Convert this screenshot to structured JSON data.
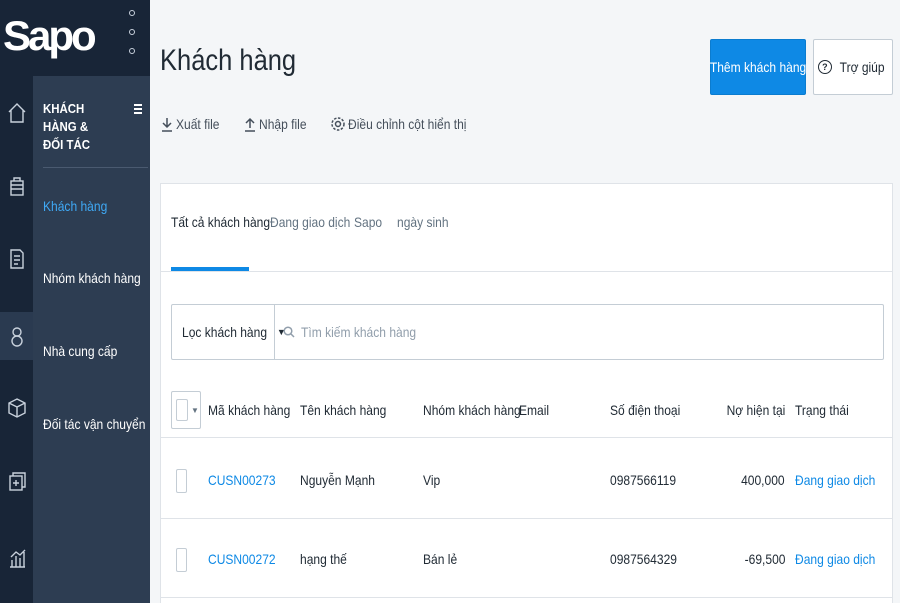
{
  "app": {
    "logo_text": "Sapo"
  },
  "rail": {
    "icons": [
      "home-icon",
      "products-icon",
      "orders-icon",
      "customers-icon",
      "box-icon",
      "inventory-icon",
      "reports-icon"
    ]
  },
  "submenu": {
    "heading": "KHÁCH HÀNG & ĐỐI TÁC",
    "items": [
      {
        "label": "Khách hàng",
        "active": true
      },
      {
        "label": "Nhóm khách hàng"
      },
      {
        "label": "Nhà cung cấp"
      },
      {
        "label": "Đối tác vận chuyển"
      }
    ]
  },
  "header": {
    "title": "Khách hàng",
    "add_button": "Thêm khách hàng",
    "help_button": "Trợ giúp"
  },
  "actions": {
    "export": "Xuất file",
    "import": "Nhập file",
    "columns": "Điều chỉnh cột hiển thị"
  },
  "tabs": [
    {
      "label": "Tất cả khách hàng",
      "active": true
    },
    {
      "label": "Đang giao dịch"
    },
    {
      "label": "Sapo"
    },
    {
      "label": "ngày sinh"
    }
  ],
  "filter": {
    "button": "Lọc khách hàng",
    "search_placeholder": "Tìm kiếm khách hàng"
  },
  "table": {
    "columns": [
      "Mã khách hàng",
      "Tên khách hàng",
      "Nhóm khách hàng",
      "Email",
      "Số điện thoại",
      "Nợ hiện tại",
      "Trạng thái"
    ],
    "rows": [
      {
        "code": "CUSN00273",
        "name": "Nguyễn Mạnh",
        "group": "Vip",
        "email": "",
        "phone": "0987566119",
        "debt": "400,000",
        "status": "Đang giao dịch"
      },
      {
        "code": "CUSN00272",
        "name": "hạng thế",
        "group": "Bán lẻ",
        "email": "",
        "phone": "0987564329",
        "debt": "-69,500",
        "status": "Đang giao dịch"
      }
    ]
  },
  "colors": {
    "accent": "#0e89e5",
    "sidebar": "#182537",
    "submenu": "#2d3d52",
    "active_link": "#3fa9f5"
  }
}
